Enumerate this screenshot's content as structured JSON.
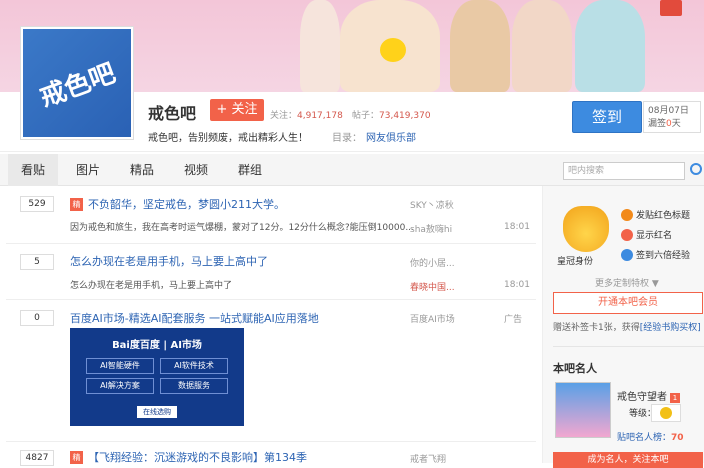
{
  "forum": {
    "logo_text": "戒色吧",
    "name": "戒色吧",
    "follow_label": "+ 关注",
    "followers_label": "关注：",
    "followers": "4,917,178",
    "posts_label": "帖子：",
    "posts": "73,419,370",
    "slogan": "戒色吧，告别频废，戒出精彩人生！",
    "catalog_label": "目录：",
    "catalog_link": "网友俱乐部"
  },
  "signin": {
    "label": "签到",
    "date": "08月07日",
    "streak_prefix": "漏签",
    "streak_days": "0",
    "streak_suffix": "天"
  },
  "tabs": [
    "看贴",
    "图片",
    "精品",
    "视频",
    "群组"
  ],
  "search": {
    "placeholder": "吧内搜索"
  },
  "posts": [
    {
      "replies": "529",
      "badge": "精",
      "title": "不负韶华，坚定戒色，梦圆小211大学。",
      "excerpt": "因为戒色和旅生，我在高考时运气爆棚，蒙对了12分。12分什么概念?能压倒10000...",
      "author": "SKY丶凉秋",
      "last_reply": "sha敖嗨hi",
      "time": "18:01"
    },
    {
      "replies": "5",
      "title": "怎么办现在老是用手机，马上要上高中了",
      "excerpt": "怎么办现在老是用手机，马上要上高中了",
      "author": "你的小居...",
      "last_reply": "春晓中国...",
      "time": "18:01"
    },
    {
      "replies": "0",
      "title": "百度AI市场-精选AI配套服务 一站式赋能AI应用落地",
      "author": "百度AI市场",
      "time": "广告",
      "ad": {
        "brand": "Bai度百度 | AI市场",
        "cells": [
          "AI智能硬件",
          "AI软件技术",
          "AI解决方案",
          "数据服务"
        ],
        "button": "在线选购"
      }
    },
    {
      "replies": "4827",
      "badge": "精",
      "title": "【飞翔经验：沉迷游戏的不良影响】第134季",
      "author": "戒者飞翔"
    }
  ],
  "sidebar": {
    "crown_label": "皇冠身份",
    "perks": [
      "发贴红色标题",
      "显示红名",
      "签到六倍经验"
    ],
    "more": "更多定制特权 ▼",
    "vip_button": "开通本吧会员",
    "vip_note_prefix": "赠送补签卡1张，获得",
    "vip_note_link": "[经验书购买权]",
    "famous_heading": "本吧名人",
    "member_name": "戒色守望者",
    "member_level_label": "等级：",
    "rank_label": "贴吧名人榜：",
    "rank_value": "70",
    "bottom_button": "成为名人，关注本吧"
  },
  "colors": {
    "accent_red": "#f26249",
    "link_blue": "#2d64b3",
    "signin_blue": "#3d8be0"
  }
}
